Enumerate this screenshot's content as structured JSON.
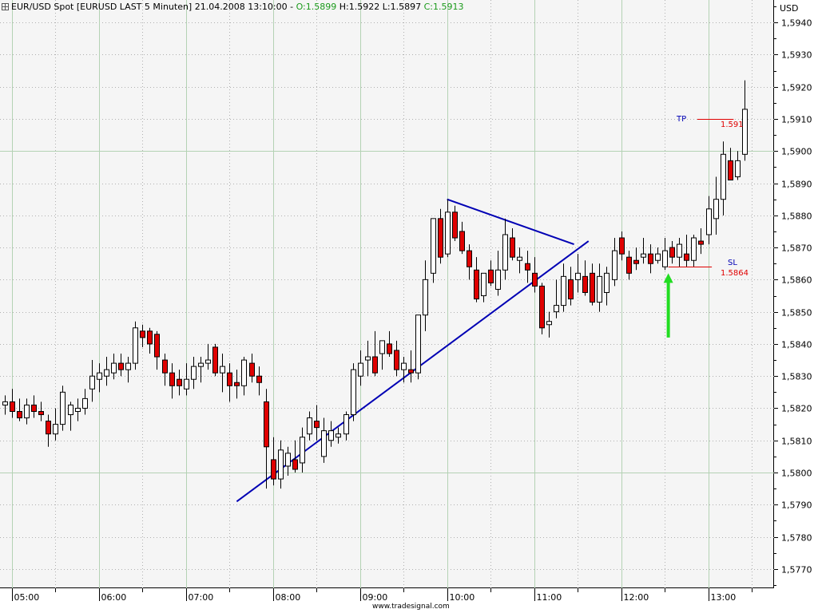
{
  "header": {
    "instrument": "EUR/USD Spot [EURUSD LAST 5 Minuten] 21.04.2008 13:10:00 -",
    "open_label": "O:",
    "open_value": "1.5899",
    "high_label": "H:",
    "high_value": "1.5922",
    "low_label": "L:",
    "low_value": "1.5897",
    "close_label": "C:",
    "close_value": "1.5913"
  },
  "currency_label": "USD",
  "watermark": "www.tradesignal.com",
  "colors": {
    "bull_candle": "#ffffff",
    "bear_candle": "#e00000",
    "trendline": "#0000b4",
    "signal_arrow": "#22dd22",
    "level_line": "#e00000",
    "level_label_name": "#0000b4",
    "level_label_value": "#e00000"
  },
  "annotations": {
    "tp": {
      "name": "TP",
      "value_text": "1.591",
      "price": 1.591
    },
    "sl": {
      "name": "SL",
      "value_text": "1.5864",
      "price": 1.5864
    }
  },
  "chart_data": {
    "type": "candlestick",
    "title": "EUR/USD Spot [EURUSD LAST 5 Minuten] 21.04.2008 13:10:00",
    "ylabel": "USD",
    "ylim": [
      1.5764,
      1.5947
    ],
    "y_ticks": [
      "1,5940",
      "1,5930",
      "1,5920",
      "1,5910",
      "1,5900",
      "1,5890",
      "1,5880",
      "1,5870",
      "1,5860",
      "1,5850",
      "1,5840",
      "1,5830",
      "1,5820",
      "1,5810",
      "1,5800",
      "1,5790",
      "1,5780",
      "1,5770"
    ],
    "y_tick_values": [
      1.594,
      1.593,
      1.592,
      1.591,
      1.59,
      1.589,
      1.588,
      1.587,
      1.586,
      1.585,
      1.584,
      1.583,
      1.582,
      1.581,
      1.58,
      1.579,
      1.578,
      1.577
    ],
    "x_ticks": [
      "05:00",
      "06:00",
      "07:00",
      "08:00",
      "09:00",
      "10:00",
      "11:00",
      "12:00",
      "13:00"
    ],
    "x_tick_bars": [
      1,
      13,
      25,
      37,
      49,
      61,
      73,
      85,
      97
    ],
    "grid": true,
    "interval": "5 Minuten",
    "candles": [
      [
        1.5821,
        1.5824,
        1.5818,
        1.5822
      ],
      [
        1.5822,
        1.5826,
        1.5817,
        1.5819
      ],
      [
        1.5819,
        1.5823,
        1.5816,
        1.5817
      ],
      [
        1.5817,
        1.5823,
        1.5815,
        1.5821
      ],
      [
        1.5821,
        1.5824,
        1.5817,
        1.5819
      ],
      [
        1.5819,
        1.5822,
        1.5816,
        1.5818
      ],
      [
        1.5816,
        1.5818,
        1.5808,
        1.5812
      ],
      [
        1.5812,
        1.582,
        1.581,
        1.5815
      ],
      [
        1.5815,
        1.5827,
        1.5813,
        1.5825
      ],
      [
        1.5818,
        1.5822,
        1.5813,
        1.5821
      ],
      [
        1.5819,
        1.5823,
        1.5816,
        1.582
      ],
      [
        1.582,
        1.5826,
        1.5818,
        1.5823
      ],
      [
        1.5826,
        1.5835,
        1.5822,
        1.583
      ],
      [
        1.5829,
        1.5834,
        1.5825,
        1.5831
      ],
      [
        1.583,
        1.5836,
        1.5827,
        1.5832
      ],
      [
        1.5831,
        1.5837,
        1.5829,
        1.5834
      ],
      [
        1.5834,
        1.5837,
        1.583,
        1.5832
      ],
      [
        1.5832,
        1.5836,
        1.5828,
        1.5834
      ],
      [
        1.5834,
        1.5847,
        1.5832,
        1.5845
      ],
      [
        1.5844,
        1.5846,
        1.5839,
        1.5842
      ],
      [
        1.5844,
        1.5845,
        1.5837,
        1.584
      ],
      [
        1.5843,
        1.5844,
        1.5832,
        1.5836
      ],
      [
        1.5835,
        1.5837,
        1.5827,
        1.5831
      ],
      [
        1.5831,
        1.5834,
        1.5823,
        1.5827
      ],
      [
        1.5829,
        1.5832,
        1.5824,
        1.5827
      ],
      [
        1.5826,
        1.5834,
        1.5824,
        1.5829
      ],
      [
        1.5829,
        1.5836,
        1.5826,
        1.5833
      ],
      [
        1.5833,
        1.5836,
        1.5828,
        1.5834
      ],
      [
        1.5834,
        1.584,
        1.5832,
        1.5835
      ],
      [
        1.5839,
        1.584,
        1.583,
        1.5831
      ],
      [
        1.5831,
        1.5837,
        1.5825,
        1.5833
      ],
      [
        1.5831,
        1.5834,
        1.5822,
        1.5827
      ],
      [
        1.5828,
        1.5832,
        1.5823,
        1.5827
      ],
      [
        1.5827,
        1.5836,
        1.5824,
        1.5835
      ],
      [
        1.5834,
        1.5837,
        1.5828,
        1.583
      ],
      [
        1.583,
        1.5833,
        1.5824,
        1.5828
      ],
      [
        1.5822,
        1.5826,
        1.5795,
        1.5808
      ],
      [
        1.5804,
        1.5811,
        1.5796,
        1.5798
      ],
      [
        1.5798,
        1.581,
        1.5795,
        1.5807
      ],
      [
        1.5802,
        1.5808,
        1.5799,
        1.5806
      ],
      [
        1.5804,
        1.581,
        1.58,
        1.5801
      ],
      [
        1.5803,
        1.5814,
        1.58,
        1.5811
      ],
      [
        1.5812,
        1.5819,
        1.581,
        1.5817
      ],
      [
        1.5816,
        1.5821,
        1.581,
        1.5814
      ],
      [
        1.5805,
        1.5817,
        1.5803,
        1.5813
      ],
      [
        1.581,
        1.5816,
        1.5808,
        1.5813
      ],
      [
        1.5811,
        1.5814,
        1.5809,
        1.5812
      ],
      [
        1.5812,
        1.5819,
        1.581,
        1.5818
      ],
      [
        1.5818,
        1.5834,
        1.5816,
        1.5832
      ],
      [
        1.583,
        1.5838,
        1.5827,
        1.5834
      ],
      [
        1.5835,
        1.5841,
        1.583,
        1.5836
      ],
      [
        1.5836,
        1.5844,
        1.583,
        1.5831
      ],
      [
        1.5837,
        1.5841,
        1.5832,
        1.5841
      ],
      [
        1.584,
        1.5844,
        1.5836,
        1.5837
      ],
      [
        1.5838,
        1.5841,
        1.583,
        1.5832
      ],
      [
        1.5832,
        1.5836,
        1.5828,
        1.5834
      ],
      [
        1.5832,
        1.5838,
        1.5828,
        1.5831
      ],
      [
        1.5831,
        1.5849,
        1.5829,
        1.5849
      ],
      [
        1.5849,
        1.5866,
        1.5844,
        1.586
      ],
      [
        1.5862,
        1.5878,
        1.5859,
        1.5879
      ],
      [
        1.5879,
        1.5882,
        1.5865,
        1.5867
      ],
      [
        1.5868,
        1.5885,
        1.5867,
        1.5881
      ],
      [
        1.5881,
        1.5883,
        1.5872,
        1.5873
      ],
      [
        1.5875,
        1.5878,
        1.5868,
        1.5869
      ],
      [
        1.5869,
        1.5871,
        1.586,
        1.5864
      ],
      [
        1.5863,
        1.5867,
        1.5853,
        1.5854
      ],
      [
        1.5855,
        1.5862,
        1.5853,
        1.5862
      ],
      [
        1.5863,
        1.5866,
        1.5858,
        1.5859
      ],
      [
        1.5857,
        1.5869,
        1.5855,
        1.5863
      ],
      [
        1.5863,
        1.5879,
        1.586,
        1.5874
      ],
      [
        1.5873,
        1.5876,
        1.5866,
        1.5867
      ],
      [
        1.5866,
        1.587,
        1.5862,
        1.5867
      ],
      [
        1.5865,
        1.5869,
        1.5859,
        1.5863
      ],
      [
        1.5862,
        1.5867,
        1.5856,
        1.5858
      ],
      [
        1.5858,
        1.5859,
        1.5843,
        1.5845
      ],
      [
        1.5846,
        1.585,
        1.5842,
        1.5847
      ],
      [
        1.585,
        1.586,
        1.5848,
        1.5852
      ],
      [
        1.5852,
        1.5865,
        1.585,
        1.5861
      ],
      [
        1.586,
        1.5864,
        1.5852,
        1.5854
      ],
      [
        1.586,
        1.5868,
        1.5856,
        1.5862
      ],
      [
        1.5861,
        1.5866,
        1.5855,
        1.5856
      ],
      [
        1.5862,
        1.5865,
        1.5852,
        1.5853
      ],
      [
        1.5853,
        1.5865,
        1.585,
        1.5861
      ],
      [
        1.5856,
        1.5864,
        1.5852,
        1.5862
      ],
      [
        1.586,
        1.5873,
        1.5858,
        1.5869
      ],
      [
        1.5873,
        1.5875,
        1.5866,
        1.5868
      ],
      [
        1.5867,
        1.5869,
        1.586,
        1.5862
      ],
      [
        1.5866,
        1.587,
        1.5863,
        1.5865
      ],
      [
        1.5867,
        1.5873,
        1.5865,
        1.5868
      ],
      [
        1.5868,
        1.5871,
        1.5862,
        1.5865
      ],
      [
        1.5866,
        1.587,
        1.5865,
        1.5868
      ],
      [
        1.5864,
        1.5873,
        1.5863,
        1.5869
      ],
      [
        1.587,
        1.5872,
        1.5865,
        1.5867
      ],
      [
        1.5867,
        1.5873,
        1.5864,
        1.5871
      ],
      [
        1.5868,
        1.5874,
        1.5864,
        1.5866
      ],
      [
        1.5866,
        1.5874,
        1.5864,
        1.5873
      ],
      [
        1.5872,
        1.5876,
        1.5868,
        1.5871
      ],
      [
        1.5874,
        1.5886,
        1.5871,
        1.5882
      ],
      [
        1.5879,
        1.5892,
        1.5874,
        1.5885
      ],
      [
        1.5885,
        1.5903,
        1.588,
        1.5899
      ],
      [
        1.5897,
        1.5901,
        1.5891,
        1.5891
      ],
      [
        1.5892,
        1.59,
        1.5891,
        1.5897
      ],
      [
        1.5899,
        1.5922,
        1.5897,
        1.5913
      ]
    ],
    "trendlines": [
      {
        "name": "resistance",
        "from": [
          61,
          1.5885
        ],
        "to": [
          78.5,
          1.5871
        ]
      },
      {
        "name": "support",
        "from": [
          32,
          1.5791
        ],
        "to": [
          80.5,
          1.5872
        ]
      }
    ],
    "levels": [
      {
        "name": "TP",
        "price": 1.591,
        "from_bar": 95.5,
        "to_bar": 100.5
      },
      {
        "name": "SL",
        "price": 1.5864,
        "from_bar": 91.5,
        "to_bar": 97.5
      }
    ],
    "signal": {
      "type": "arrow-up",
      "bar": 91.5,
      "from_price": 1.5842,
      "to_price": 1.5862
    }
  }
}
